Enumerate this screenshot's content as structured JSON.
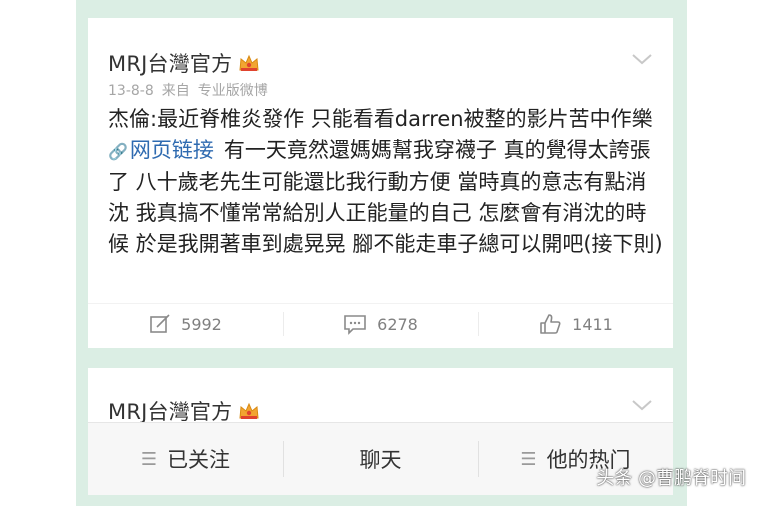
{
  "post": {
    "username": "MRJ台灣官方",
    "date": "13-8-8",
    "source_prefix": "来自",
    "source": "专业版微博",
    "text_before_link": "杰倫:最近脊椎炎發作 只能看看darren被整的影片苦中作樂",
    "link_label": "网页链接",
    "text_after_link": "有一天竟然還媽媽幫我穿襪子 真的覺得太誇張了 八十歲老先生可能還比我行動方便 當時真的意志有點消沈 我真搞不懂常常給別人正能量的自己 怎麼會有消沈的時候 於是我開著車到處晃晃 腳不能走車子總可以開吧(接下則)",
    "reposts": "5992",
    "comments": "6278",
    "likes": "1411"
  },
  "post2": {
    "username": "MRJ台灣官方"
  },
  "bottom_bar": {
    "followed": "已关注",
    "chat": "聊天",
    "hot": "他的热门"
  },
  "watermark": "头条 @曹鹏脊时间",
  "icons": {
    "crown": "crown-icon",
    "chevron": "chevron-down-icon",
    "link": "link-icon",
    "repost": "repost-icon",
    "comment": "comment-icon",
    "like": "like-icon",
    "menu": "menu-icon"
  },
  "colors": {
    "link": "#2e6ab0",
    "frame": "#dbeee4",
    "crown": "#f2a531"
  }
}
